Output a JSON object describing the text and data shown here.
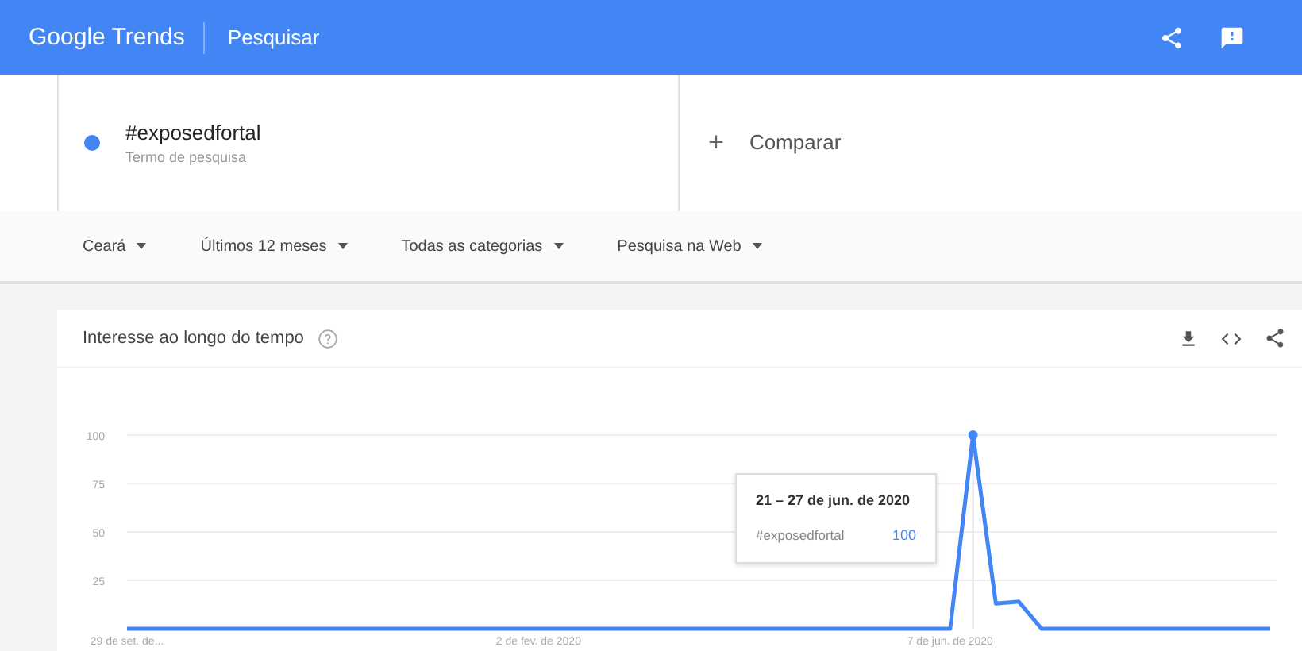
{
  "header": {
    "logo": "Google Trends",
    "page": "Pesquisar"
  },
  "search_terms": [
    {
      "term": "#exposedfortal",
      "subtitle": "Termo de pesquisa",
      "color": "#4285f4"
    }
  ],
  "compare": {
    "icon": "+",
    "label": "Comparar"
  },
  "filters": [
    {
      "label": "Ceará"
    },
    {
      "label": "Últimos 12 meses"
    },
    {
      "label": "Todas as categorias"
    },
    {
      "label": "Pesquisa na Web"
    }
  ],
  "interest_card": {
    "title": "Interesse ao longo do tempo",
    "chart_data": {
      "type": "line",
      "categories": [
        "29 de set. de...",
        null,
        null,
        null,
        null,
        null,
        null,
        null,
        null,
        null,
        null,
        null,
        null,
        null,
        null,
        null,
        null,
        null,
        "2 de fev. de 2020",
        null,
        null,
        null,
        null,
        null,
        null,
        null,
        null,
        null,
        null,
        null,
        null,
        null,
        null,
        null,
        null,
        null,
        "7 de jun. de 2020",
        null,
        null,
        null,
        null,
        null,
        null,
        null,
        null,
        null,
        null,
        null,
        null,
        null,
        null
      ],
      "series": [
        {
          "name": "#exposedfortal",
          "color": "#4285f4",
          "values": [
            0,
            0,
            0,
            0,
            0,
            0,
            0,
            0,
            0,
            0,
            0,
            0,
            0,
            0,
            0,
            0,
            0,
            0,
            0,
            0,
            0,
            0,
            0,
            0,
            0,
            0,
            0,
            0,
            0,
            0,
            0,
            0,
            0,
            0,
            0,
            0,
            0,
            100,
            13,
            14,
            0,
            0,
            0,
            0,
            0,
            0,
            0,
            0,
            0,
            0,
            0
          ]
        }
      ],
      "ylim": [
        0,
        100
      ],
      "grid": true,
      "yticks": [
        25,
        50,
        75,
        100
      ]
    },
    "tooltip": {
      "date": "21 – 27 de jun. de 2020",
      "value": "100"
    }
  }
}
